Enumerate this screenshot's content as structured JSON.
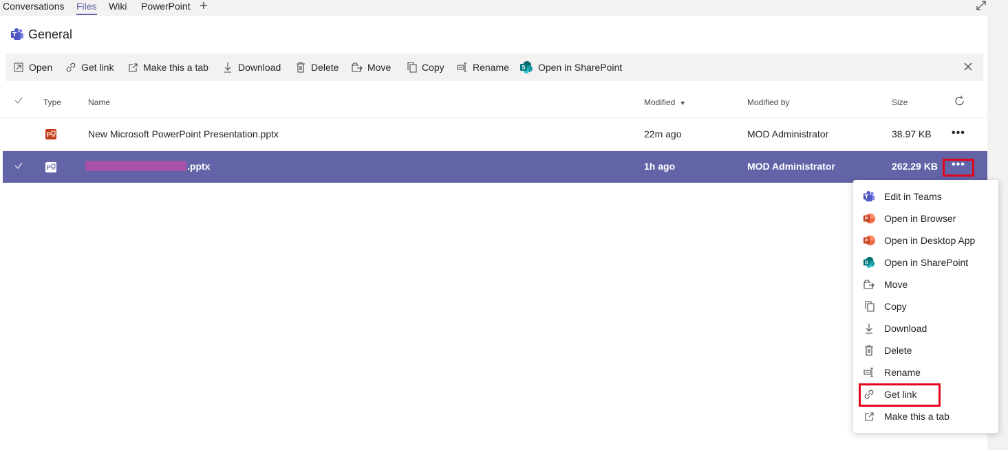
{
  "tabs": [
    {
      "label": "Conversations",
      "active": false
    },
    {
      "label": "Files",
      "active": true
    },
    {
      "label": "Wiki",
      "active": false
    },
    {
      "label": "PowerPoint",
      "active": false
    }
  ],
  "channel": {
    "title": "General"
  },
  "commands": {
    "open": "Open",
    "get_link": "Get link",
    "make_tab": "Make this a tab",
    "download": "Download",
    "delete": "Delete",
    "move": "Move",
    "copy": "Copy",
    "rename": "Rename",
    "open_sharepoint": "Open in SharePoint"
  },
  "columns": {
    "type": "Type",
    "name": "Name",
    "modified": "Modified",
    "modified_by": "Modified by",
    "size": "Size"
  },
  "files": [
    {
      "name": "New Microsoft PowerPoint Presentation.pptx",
      "modified": "22m ago",
      "modified_by": "MOD Administrator",
      "size": "38.97 KB",
      "selected": false
    },
    {
      "name": ".pptx",
      "modified": "1h ago",
      "modified_by": "MOD Administrator",
      "size": "262.29 KB",
      "selected": true
    }
  ],
  "more_label": "•••",
  "context_menu": [
    {
      "label": "Edit in Teams",
      "icon": "teams-icon"
    },
    {
      "label": "Open in Browser",
      "icon": "powerpoint-icon"
    },
    {
      "label": "Open in Desktop App",
      "icon": "powerpoint-icon"
    },
    {
      "label": "Open in SharePoint",
      "icon": "sharepoint-icon"
    },
    {
      "label": "Move",
      "icon": "move-icon"
    },
    {
      "label": "Copy",
      "icon": "copy-icon"
    },
    {
      "label": "Download",
      "icon": "download-icon"
    },
    {
      "label": "Delete",
      "icon": "delete-icon"
    },
    {
      "label": "Rename",
      "icon": "rename-icon"
    },
    {
      "label": "Get link",
      "icon": "link-icon"
    },
    {
      "label": "Make this a tab",
      "icon": "tab-icon"
    }
  ],
  "colors": {
    "accent": "#6264a7",
    "highlight": "#e3051b",
    "powerpoint": "#c43e1c",
    "sharepoint": "#038387"
  }
}
